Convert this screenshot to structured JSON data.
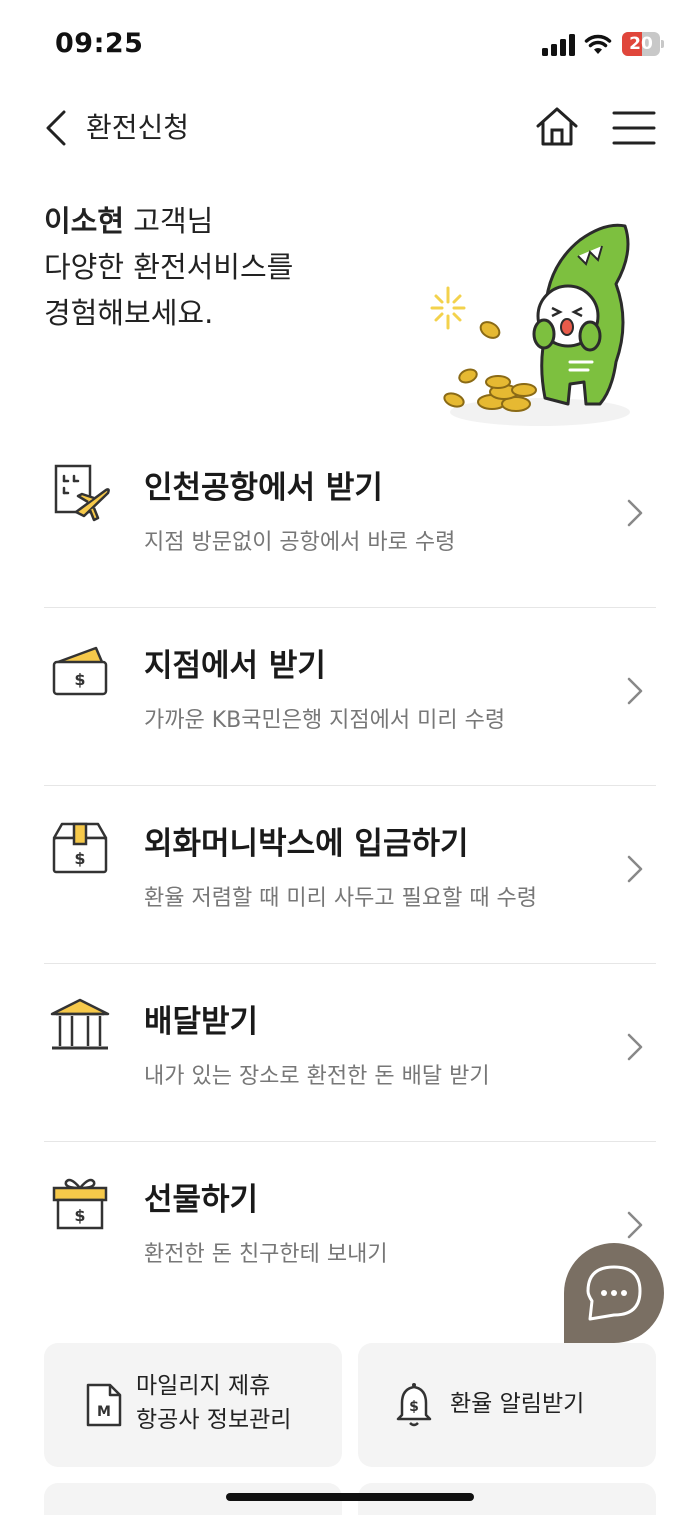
{
  "status_bar": {
    "time": "09:25",
    "battery_level": "20",
    "battery_color": "#e0463b"
  },
  "header": {
    "title": "환전신청",
    "back_icon": "chevron-left-icon",
    "home_icon": "home-icon",
    "menu_icon": "hamburger-menu-icon"
  },
  "greeting": {
    "name": "이소현",
    "suffix": " 고객님",
    "line2": "다양한 환전서비스를",
    "line3": "경험해보세요."
  },
  "services": [
    {
      "title": "인천공항에서 받기",
      "description": "지점 방문없이 공항에서 바로 수령",
      "icon": "airport-plane-icon"
    },
    {
      "title": "지점에서 받기",
      "description": "가까운 KB국민은행 지점에서 미리 수령",
      "icon": "wallet-icon"
    },
    {
      "title": "외화머니박스에 입금하기",
      "description": "환율 저렴할 때 미리 사두고 필요할 때 수령",
      "icon": "money-box-icon"
    },
    {
      "title": "배달받기",
      "description": "내가 있는 장소로 환전한 돈 배달 받기",
      "icon": "bank-building-icon"
    },
    {
      "title": "선물하기",
      "description": "환전한 돈 친구한테 보내기",
      "icon": "gift-icon"
    }
  ],
  "cards": {
    "mileage_line1": "마일리지 제휴",
    "mileage_line2": "항공사 정보관리",
    "mileage_icon": "mileage-document-icon",
    "rate_alert": "환율 알림받기",
    "rate_alert_icon": "bell-dollar-icon"
  },
  "chat": {
    "icon": "chat-bubble-icon"
  },
  "colors": {
    "accent_yellow": "#f6c94a",
    "mascot_green": "#7dc03f",
    "fab": "#7a6f63"
  }
}
